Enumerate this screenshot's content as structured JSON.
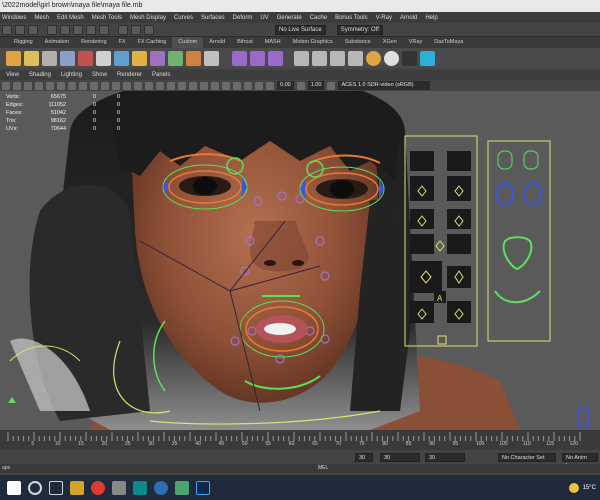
{
  "window": {
    "title": "\\2022model\\girl brown\\maya file\\maya file.mb"
  },
  "menubar": {
    "items": [
      "Windows",
      "Mesh",
      "Edit Mesh",
      "Mesh Tools",
      "Mesh Display",
      "Curves",
      "Surfaces",
      "Deform",
      "UV",
      "Generate",
      "Cache",
      "Bonus Tools",
      "V-Ray",
      "Arnold",
      "Help"
    ]
  },
  "statusline": {
    "live_surface": "No Live Surface",
    "symmetry": "Symmetry: Off"
  },
  "shelf": {
    "tabs": [
      "Rigging",
      "Animation",
      "Rendering",
      "FX",
      "FX Caching",
      "Custom",
      "Arnold",
      "Bifrost",
      "MASH",
      "Motion Graphics",
      "Substance",
      "XGen",
      "VRay",
      "DazToMaya"
    ],
    "active_tab": "Custom"
  },
  "panel": {
    "menu": [
      "View",
      "Shading",
      "Lighting",
      "Show",
      "Renderer",
      "Panels"
    ],
    "exposure": "0.00",
    "gamma": "1.00",
    "color_space": "ACES 1.0 SDR-video (sRGB)"
  },
  "hud": {
    "rows": [
      {
        "label": "Verts:",
        "v1": "65675",
        "v2": "0",
        "v3": "0"
      },
      {
        "label": "Edges:",
        "v1": "111052",
        "v2": "0",
        "v3": "0"
      },
      {
        "label": "Faces:",
        "v1": "51042",
        "v2": "0",
        "v3": "0"
      },
      {
        "label": "Tris:",
        "v1": "98162",
        "v2": "0",
        "v3": "0"
      },
      {
        "label": "UVs:",
        "v1": "70644",
        "v2": "0",
        "v3": "0"
      }
    ]
  },
  "timeline": {
    "ticks": [
      "5",
      "10",
      "15",
      "20",
      "25",
      "30",
      "35",
      "40",
      "45",
      "50",
      "55",
      "60",
      "65",
      "70",
      "75",
      "80",
      "85",
      "90",
      "95",
      "100",
      "105",
      "110",
      "115",
      "120"
    ]
  },
  "range": {
    "start": "30",
    "end": "30",
    "current": "30",
    "character_set": "No Character Set",
    "anim_layer": "No Anim Layer"
  },
  "cmdline": {
    "label": "MEL",
    "left_text": "aps"
  },
  "tray": {
    "temperature": "15°C"
  },
  "colors": {
    "maya_orange": "#e87b2c",
    "rig_green": "#5ce05c",
    "rig_yellow": "#e0e070",
    "rig_blue": "#3a56e0",
    "taskbar_bg": "#1f2b3a"
  },
  "icons": [
    "selection-icon",
    "lasso-icon",
    "paint-icon",
    "snap-grid-icon",
    "snap-curve-icon",
    "snap-point-icon",
    "render-icon",
    "windows-start-icon",
    "search-icon",
    "task-view-icon",
    "file-explorer-icon",
    "chrome-icon",
    "maya-icon",
    "photoshop-icon",
    "weather-icon"
  ]
}
